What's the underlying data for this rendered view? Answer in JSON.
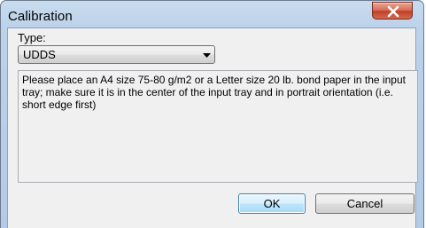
{
  "window": {
    "title": "Calibration"
  },
  "form": {
    "type_label": "Type:",
    "type_value": "UDDS",
    "message": "Please place an A4 size 75-80 g/m2 or a Letter size 20 lb. bond paper in the input tray; make sure it is in the center of the input tray and in portrait orientation (i.e. short edge first)"
  },
  "buttons": {
    "ok_label": "OK",
    "cancel_label": "Cancel"
  },
  "icons": {
    "close": "close-icon",
    "dropdown": "chevron-down-icon"
  },
  "colors": {
    "titlebar": "#bcd2ea",
    "close_button": "#c2402a",
    "dialog_background": "#f0f0f0",
    "default_button_border": "#3c7fb1"
  }
}
